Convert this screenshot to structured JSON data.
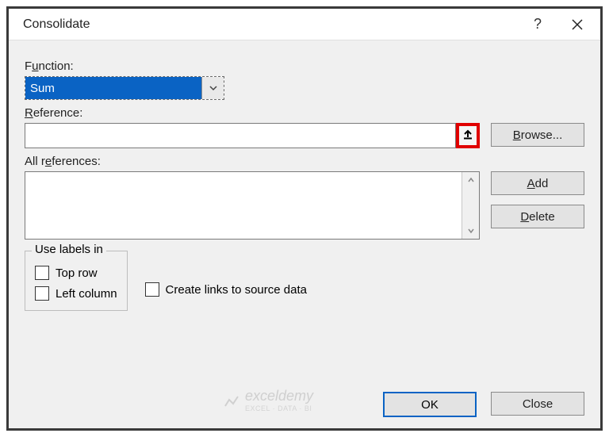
{
  "dialog": {
    "title": "Consolidate"
  },
  "function": {
    "label_pre": "F",
    "label_u": "u",
    "label_post": "nction:",
    "value": "Sum"
  },
  "reference": {
    "label_pre": "",
    "label_u": "R",
    "label_post": "eference:",
    "value": "",
    "browse_pre": "",
    "browse_u": "B",
    "browse_post": "rowse..."
  },
  "allrefs": {
    "label_pre": "All r",
    "label_u": "e",
    "label_post": "ferences:",
    "add_u": "A",
    "add_post": "dd",
    "delete_u": "D",
    "delete_post": "elete"
  },
  "uselabels": {
    "legend": "Use labels in",
    "top_u": "T",
    "top_post": "op row",
    "left_u": "L",
    "left_post": "eft column"
  },
  "createlinks": {
    "pre": "Create links to ",
    "u": "s",
    "post": "ource data"
  },
  "footer": {
    "ok": "OK",
    "close": "Close"
  },
  "watermark": {
    "main": "exceldemy",
    "sub": "EXCEL · DATA · BI"
  }
}
